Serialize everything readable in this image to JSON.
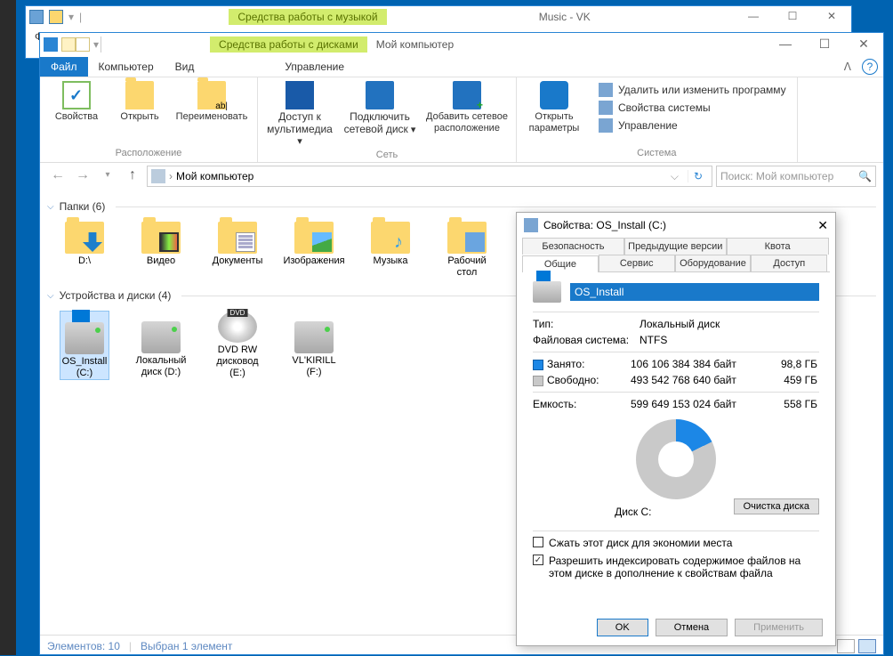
{
  "music_window": {
    "context_tab": "Средства работы с музыкой",
    "title": "Music - VK",
    "menu": {
      "file": "Фа...",
      "other": "..."
    }
  },
  "pc_window": {
    "context_tab": "Средства работы с дисками",
    "title": "Мой компьютер",
    "menu": {
      "file": "Файл",
      "computer": "Компьютер",
      "view": "Вид",
      "manage": "Управление"
    },
    "ribbon": {
      "group_location": "Расположение",
      "properties": "Свойства",
      "open": "Открыть",
      "rename": "Переименовать",
      "group_network": "Сеть",
      "media": "Доступ к\nмультимедиа",
      "map_drive": "Подключить\nсетевой диск",
      "add_net": "Добавить сетевое\nрасположение",
      "group_system": "Система",
      "open_settings": "Открыть\nпараметры",
      "sys_uninstall": "Удалить или изменить программу",
      "sys_props": "Свойства системы",
      "sys_manage": "Управление"
    },
    "address": {
      "path": "Мой компьютер",
      "search_placeholder": "Поиск: Мой компьютер"
    },
    "folders_hdr": "Папки (6)",
    "folders": [
      {
        "name": "D:\\"
      },
      {
        "name": "Видео"
      },
      {
        "name": "Документы"
      },
      {
        "name": "Изображения"
      },
      {
        "name": "Музыка"
      },
      {
        "name": "Рабочий стол"
      }
    ],
    "drives_hdr": "Устройства и диски (4)",
    "drives": [
      {
        "name": "OS_Install (C:)"
      },
      {
        "name": "Локальный диск (D:)"
      },
      {
        "name": "DVD RW дисковод (E:)"
      },
      {
        "name": "VL'KIRILL (F:)"
      }
    ],
    "status": {
      "items": "Элементов: 10",
      "selected": "Выбран 1 элемент"
    }
  },
  "props": {
    "title": "Свойства: OS_Install (C:)",
    "tabs": {
      "security": "Безопасность",
      "prev": "Предыдущие версии",
      "quota": "Квота",
      "general": "Общие",
      "service": "Сервис",
      "hardware": "Оборудование",
      "access": "Доступ"
    },
    "vol_name": "OS_Install",
    "type_lbl": "Тип:",
    "type_val": "Локальный диск",
    "fs_lbl": "Файловая система:",
    "fs_val": "NTFS",
    "used_lbl": "Занято:",
    "used_bytes": "106 106 384 384 байт",
    "used_gb": "98,8 ГБ",
    "free_lbl": "Свободно:",
    "free_bytes": "493 542 768 640 байт",
    "free_gb": "459 ГБ",
    "cap_lbl": "Емкость:",
    "cap_bytes": "599 649 153 024 байт",
    "cap_gb": "558 ГБ",
    "disk_lbl": "Диск C:",
    "clean_btn": "Очистка диска",
    "chk_compress": "Сжать этот диск для экономии места",
    "chk_index": "Разрешить индексировать содержимое файлов на этом диске в дополнение к свойствам файла",
    "btn_ok": "OK",
    "btn_cancel": "Отмена",
    "btn_apply": "Применить"
  }
}
